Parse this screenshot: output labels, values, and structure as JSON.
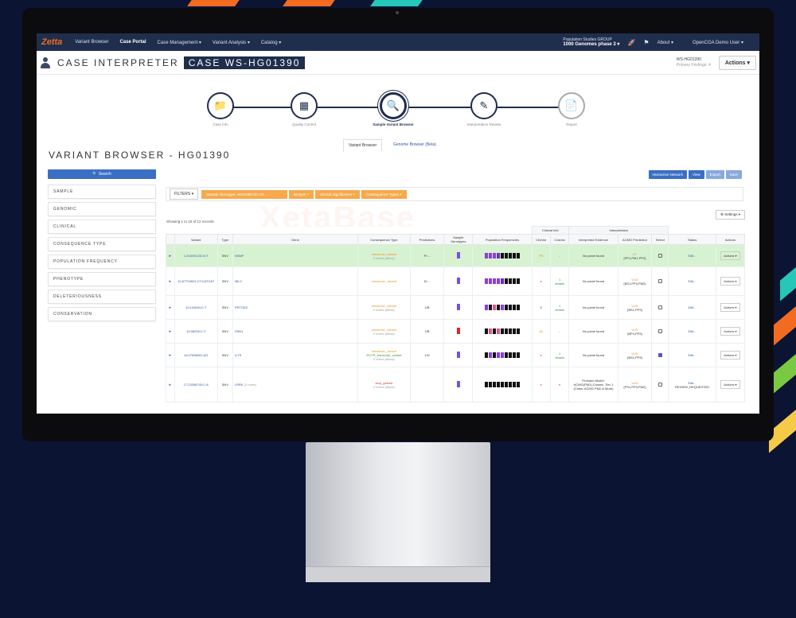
{
  "app": {
    "logo": "Zetta"
  },
  "topnav": {
    "items": [
      "Variant Browser",
      "Case Portal",
      "Case Management ▾",
      "Variant Analysis ▾",
      "Catalog ▾"
    ],
    "active_index": 1,
    "project_line1": "Population Studies GROUP",
    "project_line2": "1000 Genomes phase 3 ▾",
    "about": "About ▾",
    "user": "OpenCGA Demo User ▾"
  },
  "header": {
    "title": "CASE INTERPRETER",
    "case_id": "CASE WS-HG01390",
    "ws_id": "WS-HG01390",
    "ws_sub": "Primary Findings: 4",
    "actions": "Actions ▾"
  },
  "stepper": {
    "steps": [
      {
        "label": "Case Info",
        "icon": "📁"
      },
      {
        "label": "Quality Control",
        "icon": "▦"
      },
      {
        "label": "Sample Variant Browser",
        "icon": "🔍"
      },
      {
        "label": "Interpretation Review",
        "icon": "✎"
      },
      {
        "label": "Report",
        "icon": "📄"
      }
    ],
    "active_index": 2
  },
  "subtabs": [
    "Variant Browser",
    "Genome Browser (Beta)"
  ],
  "variant_browser": {
    "title": "VARIANT BROWSER - HG01390",
    "search_label": "🔍 Search",
    "facets": [
      "SAMPLE",
      "GENOMIC",
      "CLINICAL",
      "CONSEQUENCE TYPE",
      "POPULATION FREQUENCY",
      "PHENOTYPE",
      "DELETERIOUSNESS",
      "CONSERVATION"
    ],
    "toolbar": [
      "Interactive Network",
      "View",
      "Export",
      "Save"
    ],
    "filters_label": "FILTERS ▾",
    "chips": [
      "Sample Genotype: HG01390 0/1,1/1 ...",
      "Biotype ×",
      "Clinical Significance ×",
      "Consequence Types ×"
    ],
    "watermark": "XetaBase",
    "showing": "Showing 1 to 10 of 12 records",
    "settings": "⚙ Settings ▾"
  },
  "table": {
    "headers": [
      "",
      "Variant",
      "Type",
      "Gene",
      "Consequence Type",
      "Predictions",
      "Sample Genotypes",
      "Population Frequencies",
      "ClinVar",
      "Cosmic",
      "Interpreted Evidence",
      "ACMG Prediction",
      "Select",
      "Status",
      "Actions"
    ],
    "group_clinical": "Clinical Info",
    "group_interp": "Interpretation",
    "rows": [
      {
        "variant": "1:234091231:G:T",
        "type": "SNV",
        "gene": "NSMF",
        "cons": "missense_variant",
        "cons_class": "orange",
        "cons2": "2 terms (Allow)",
        "pred": "P/- -",
        "clinvar": "PB",
        "cosmic": "-",
        "evidence": "No panel found",
        "acmg": "LP",
        "acmg2": "(PP1,PM1,PP3)",
        "select": false,
        "status": "Edit...",
        "action": "Actions ▾",
        "hl": true
      },
      {
        "variant": "10:67794521:CT:CATGAT",
        "type": "SNV",
        "gene": "MIL2",
        "cons": "missense_variant",
        "cons_class": "orange",
        "cons2": "",
        "pred": "D/- -",
        "clinvar": "×",
        "cosmic": "1",
        "cosmic2": "details",
        "evidence": "No panel found",
        "acmg": "VUS",
        "acmg2": "(BS1,PP3,PM2)",
        "select": false,
        "status": "Edit...",
        "action": "Actions ▾",
        "hl": false
      },
      {
        "variant": "10:104694:C:T",
        "type": "SNV",
        "gene": "PRTGD2",
        "cons": "missense_variant",
        "cons_class": "orange",
        "cons2": "2 terms (Allow)",
        "pred": "1/B",
        "clinvar": "V",
        "cosmic": "1",
        "cosmic2": "details",
        "evidence": "No panel found",
        "acmg": "VUS",
        "acmg2": "(BS1,PP3)",
        "select": false,
        "status": "Edit...",
        "action": "Actions ▾",
        "hl": false
      },
      {
        "variant": "14:98205:C:T",
        "type": "SNV",
        "gene": "FBN1",
        "cons": "missense_variant",
        "cons_class": "orange",
        "cons2": "2 terms (Allow)",
        "pred": "1/B",
        "clinvar": "VA",
        "cosmic": "-",
        "evidence": "No panel found",
        "acmg": "VUS",
        "acmg2": "(BP4,PP3)",
        "select": false,
        "status": "Edit...",
        "action": "Actions ▾",
        "hl": false
      },
      {
        "variant": "16:27898002:AG",
        "type": "SNV",
        "gene": "ILYS",
        "cons": "missense_variant",
        "cons_class": "green",
        "cons2": "5'UTR_transcript_variant",
        "cons3": "2 terms (Allow)",
        "pred": "1/D",
        "clinvar": "×",
        "cosmic": "1",
        "cosmic2": "details",
        "evidence": "No panel found",
        "acmg": "VUS",
        "acmg2": "(BS1,PP3)",
        "select": true,
        "status": "Edit...",
        "action": "Actions ▾",
        "hl": false
      },
      {
        "variant": "17:23308743:C:A",
        "type": "SNV",
        "gene": "LRRK",
        "gene2": "(2 more)",
        "cons": "stop_gained",
        "cons_class": "red",
        "cons2": "2 terms (Allow)",
        "pred": "",
        "clinvar": "×",
        "cosmic": "×",
        "evidence": "Proband Model: ACMG(PM1),Cosmic, Tier 1 (Class: ACMG PM2 & More)",
        "acmg": "VUS",
        "acmg2": "(PS1,PP3,PM2)",
        "select": false,
        "status": "Edit...",
        "status2": "REVIEW_REQUESTED",
        "action": "Actions ▾",
        "hl": false
      }
    ]
  },
  "colors": {
    "navy": "#1f2e4d",
    "accent": "#3b6fc4",
    "orange_chip": "#f7a94b",
    "highlight_row": "#d7f2d1"
  }
}
